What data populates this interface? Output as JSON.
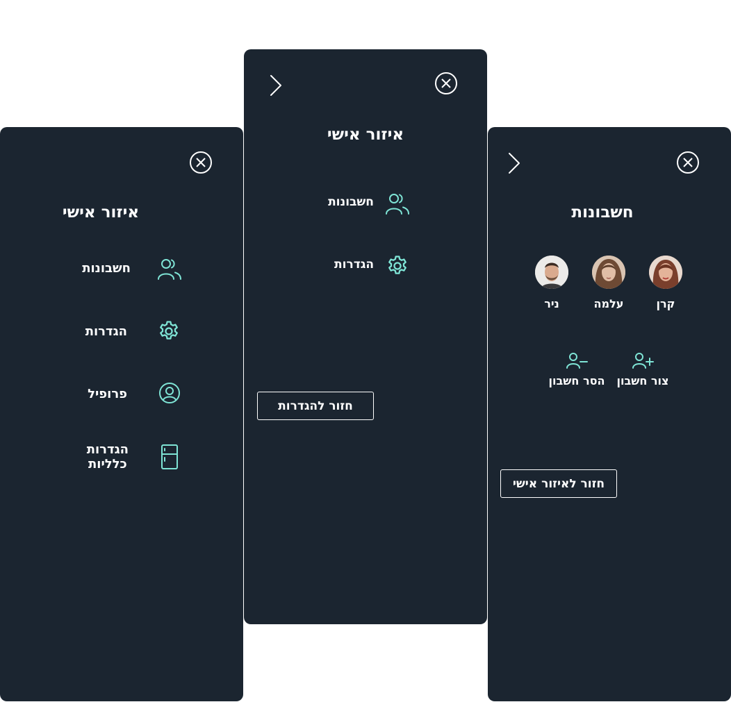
{
  "colors": {
    "panel_bg": "#1b2530",
    "accent": "#7fe5d6",
    "text": "#ffffff"
  },
  "left_panel": {
    "title": "איזור אישי",
    "close_icon": "close-circle-icon",
    "items": [
      {
        "label": "חשבונות",
        "icon": "users-icon"
      },
      {
        "label": "הגדרות",
        "icon": "gear-icon"
      },
      {
        "label": "פרופיל",
        "icon": "user-circle-icon"
      },
      {
        "label": "הגדרות\nכלליות",
        "icon": "fridge-icon"
      }
    ]
  },
  "mid_panel": {
    "title": "איזור אישי",
    "close_icon": "close-circle-icon",
    "back_icon": "chevron-right-icon",
    "items": [
      {
        "label": "חשבונות",
        "icon": "users-icon"
      },
      {
        "label": "הגדרות",
        "icon": "gear-icon"
      }
    ],
    "back_button_label": "חזור להגדרות"
  },
  "right_panel": {
    "title": "חשבונות",
    "close_icon": "close-circle-icon",
    "back_icon": "chevron-right-icon",
    "accounts": [
      {
        "name": "קרן"
      },
      {
        "name": "עלמה"
      },
      {
        "name": "ניר"
      }
    ],
    "actions": {
      "create_label": "צור חשבון",
      "remove_label": "הסר חשבון"
    },
    "back_button_label": "חזור לאיזור אישי"
  }
}
